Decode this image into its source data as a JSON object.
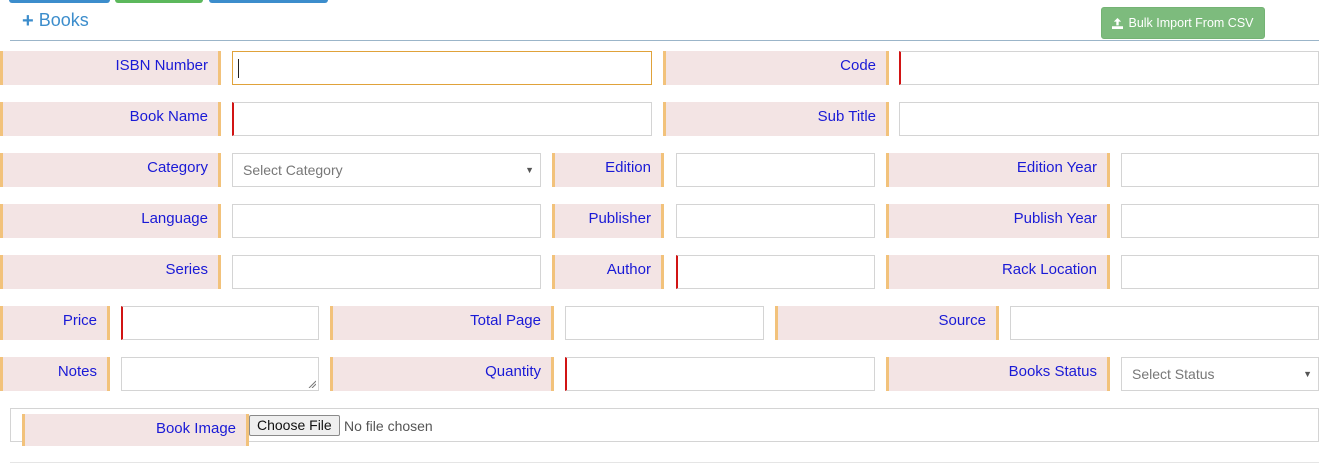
{
  "header": {
    "title": "Books",
    "title_icon": "plus-icon",
    "bulk_import_label": "Bulk Import From CSV",
    "bulk_import_icon": "upload-icon"
  },
  "colors": {
    "accent": "#3c8dcc",
    "success": "#7dbb7d",
    "label_bg": "#f3e4e4",
    "label_border": "#f2c27b",
    "required_border": "#d11414",
    "label_text": "#1a1ad6"
  },
  "form": {
    "isbn_label": "ISBN Number",
    "isbn_value": "",
    "code_label": "Code",
    "code_value": "",
    "book_name_label": "Book Name",
    "book_name_value": "",
    "sub_title_label": "Sub Title",
    "sub_title_value": "",
    "category_label": "Category",
    "category_selected": "Select Category",
    "edition_label": "Edition",
    "edition_value": "",
    "edition_year_label": "Edition Year",
    "edition_year_value": "",
    "language_label": "Language",
    "language_value": "",
    "publisher_label": "Publisher",
    "publisher_value": "",
    "publish_year_label": "Publish Year",
    "publish_year_value": "",
    "series_label": "Series",
    "series_value": "",
    "author_label": "Author",
    "author_value": "",
    "rack_location_label": "Rack Location",
    "rack_location_value": "",
    "price_label": "Price",
    "price_value": "",
    "total_page_label": "Total Page",
    "total_page_value": "",
    "source_label": "Source",
    "source_value": "",
    "notes_label": "Notes",
    "notes_value": "",
    "quantity_label": "Quantity",
    "quantity_value": "",
    "books_status_label": "Books Status",
    "books_status_selected": "Select Status",
    "book_image_label": "Book Image",
    "choose_file_label": "Choose File",
    "no_file_text": "No file chosen"
  }
}
